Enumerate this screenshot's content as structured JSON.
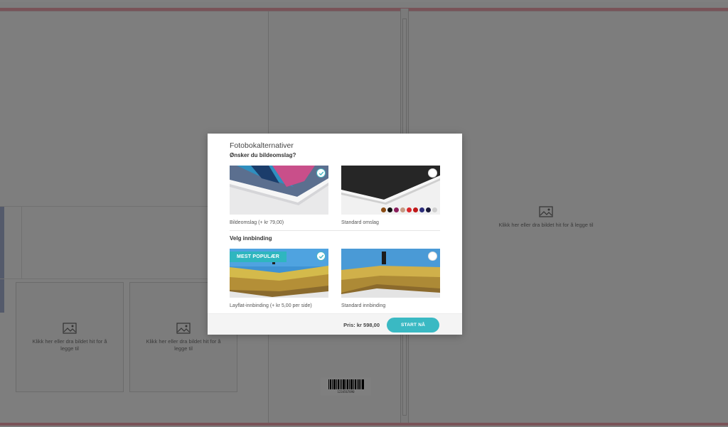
{
  "canvas": {
    "placeholder_text": "Klikk her eller dra bildet hit for å legge til",
    "barcode_number": "1234567890"
  },
  "modal": {
    "title": "Fotobokalternativer",
    "cover_section_title": "Ønsker du bildeomslag?",
    "cover_options": [
      {
        "label": "Bildeomslag (+ kr 79,00)",
        "selected": true
      },
      {
        "label": "Standard omslag",
        "selected": false
      }
    ],
    "cover_swatch_colors": [
      "#8a4b12",
      "#111111",
      "#8b1f5c",
      "#c69a84",
      "#d9262b",
      "#c01818",
      "#2b2c7a",
      "#1a1a3a",
      "#d0d0d0"
    ],
    "binding_section_title": "Velg innbinding",
    "binding_options": [
      {
        "label": "Layflat-innbinding (+ kr 5,00 per side)",
        "selected": true,
        "badge": "MEST POPULÆR"
      },
      {
        "label": "Standard innbinding",
        "selected": false
      }
    ],
    "price_label": "Pris: kr 598,00",
    "start_button": "START NÅ"
  },
  "colors": {
    "accent": "#3ab9c3",
    "page_guide": "#f3a6b1"
  },
  "icons": [
    "image-placeholder-icon",
    "check-icon",
    "barcode-icon"
  ]
}
